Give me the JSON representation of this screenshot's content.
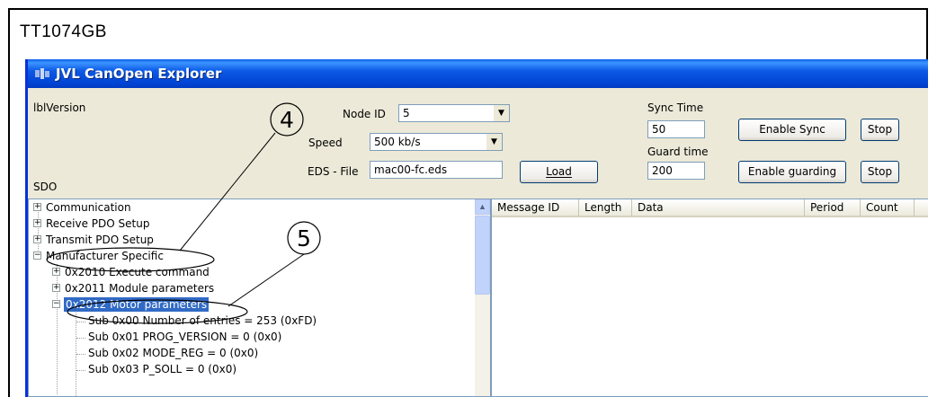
{
  "document": {
    "id": "TT1074GB"
  },
  "window": {
    "title": "JVL CanOpen Explorer"
  },
  "header": {
    "version_label": "lblVersion",
    "sdo_label": "SDO",
    "node_id_label": "Node ID",
    "node_id_value": "5",
    "speed_label": "Speed",
    "speed_value": "500 kb/s",
    "eds_label": "EDS - File",
    "eds_value": "mac00-fc.eds",
    "load_button": "Load",
    "sync_time_label": "Sync Time",
    "sync_time_value": "50",
    "guard_time_label": "Guard time",
    "guard_time_value": "200",
    "enable_sync_button": "Enable Sync",
    "stop_sync_button": "Stop",
    "enable_guarding_button": "Enable guarding",
    "stop_guarding_button": "Stop"
  },
  "tree": {
    "items": [
      {
        "label": "Communication",
        "expander": "+"
      },
      {
        "label": "Receive PDO Setup",
        "expander": "+"
      },
      {
        "label": "Transmit PDO Setup",
        "expander": "+"
      },
      {
        "label": "Manufacturer Specific",
        "expander": "−"
      },
      {
        "label": "0x2010 Execute command",
        "expander": "+"
      },
      {
        "label": "0x2011 Module parameters",
        "expander": "+"
      },
      {
        "label": "0x2012 Motor parameters",
        "expander": "−"
      },
      {
        "label": "Sub 0x00 Number of entries = 253 (0xFD)"
      },
      {
        "label": "Sub 0x01 PROG_VERSION = 0 (0x0)"
      },
      {
        "label": "Sub 0x02 MODE_REG = 0 (0x0)"
      },
      {
        "label": "Sub 0x03 P_SOLL = 0 (0x0)"
      }
    ]
  },
  "message_list": {
    "columns": [
      "Message ID",
      "Length",
      "Data",
      "Period",
      "Count"
    ]
  },
  "callouts": {
    "four": "4",
    "five": "5"
  },
  "colors": {
    "titlebar": "#0054e3",
    "selection": "#316ac5",
    "window_bg": "#ece9d8"
  }
}
